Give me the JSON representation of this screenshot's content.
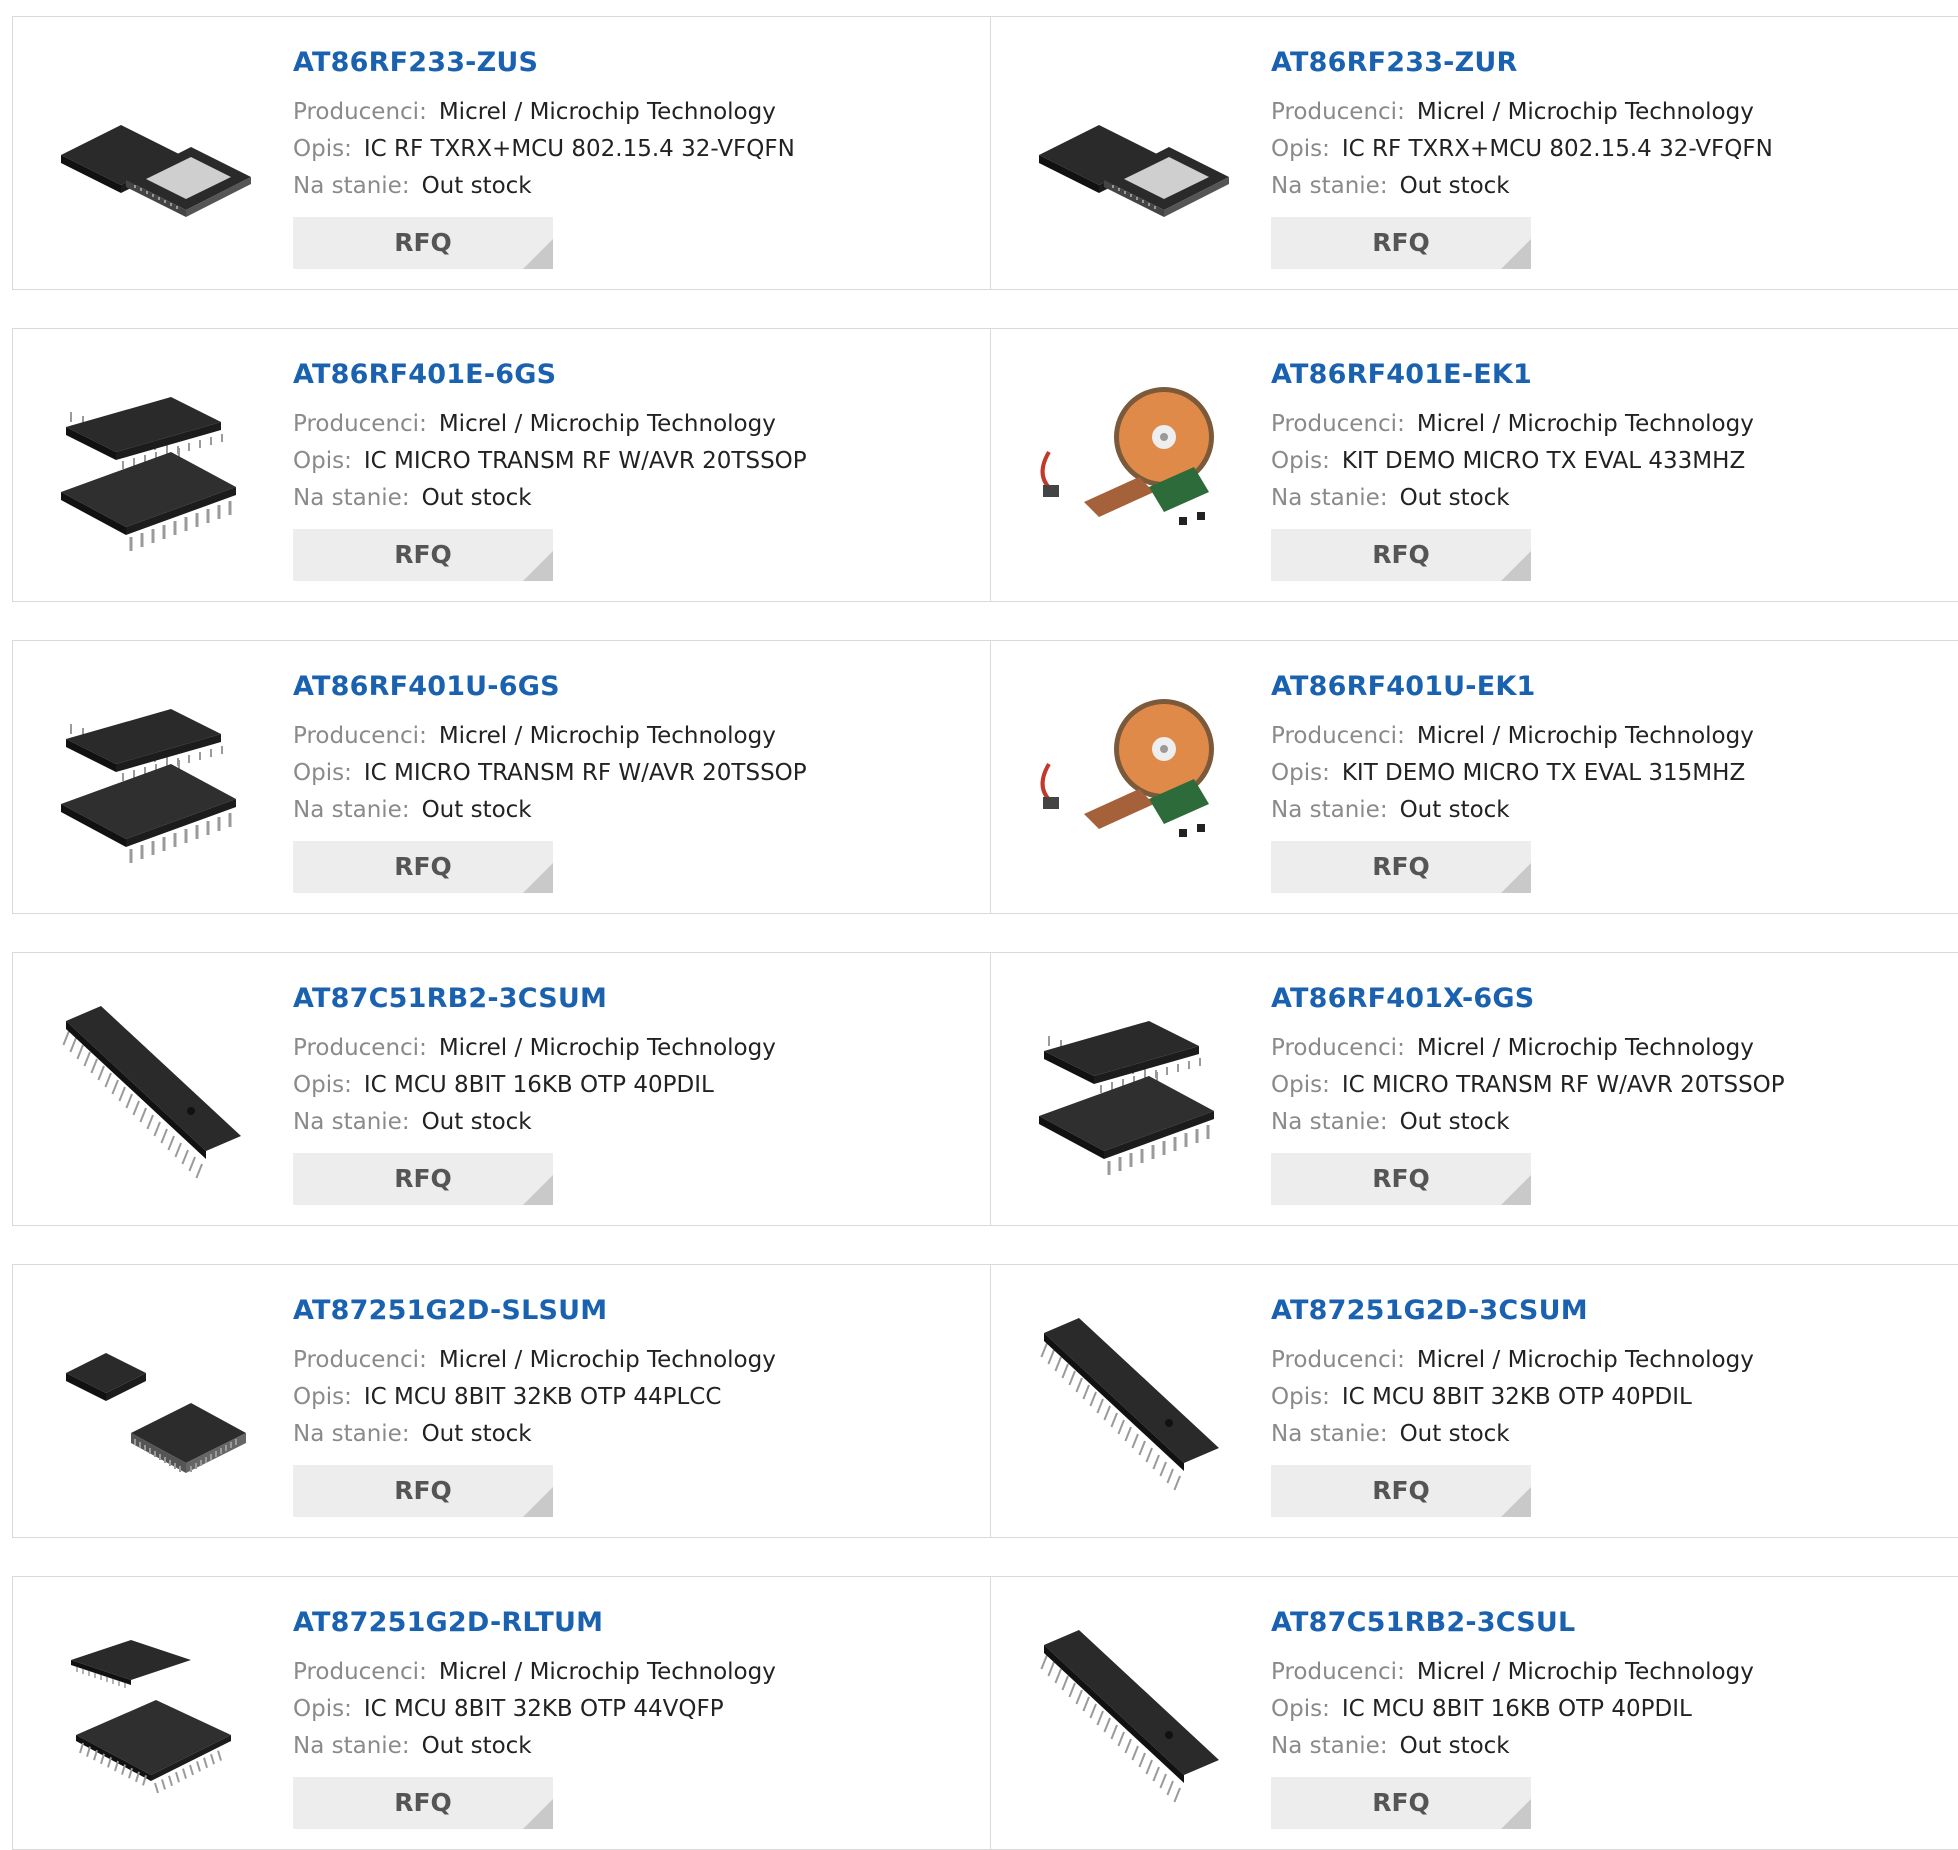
{
  "labels": {
    "manufacturer": "Producenci:",
    "description": "Opis:",
    "stock": "Na stanie:",
    "rfq": "RFQ"
  },
  "products": [
    {
      "part": "AT86RF233-ZUS",
      "manufacturer": "Micrel / Microchip Technology",
      "description": "IC RF TXRX+MCU 802.15.4 32-VFQFN",
      "stock": "Out stock",
      "image": "qfn-chip-icon"
    },
    {
      "part": "AT86RF233-ZUR",
      "manufacturer": "Micrel / Microchip Technology",
      "description": "IC RF TXRX+MCU 802.15.4 32-VFQFN",
      "stock": "Out stock",
      "image": "qfn-chip-icon"
    },
    {
      "part": "AT86RF401E-6GS",
      "manufacturer": "Micrel / Microchip Technology",
      "description": "IC MICRO TRANSM RF W/AVR 20TSSOP",
      "stock": "Out stock",
      "image": "tssop-chip-icon"
    },
    {
      "part": "AT86RF401E-EK1",
      "manufacturer": "Micrel / Microchip Technology",
      "description": "KIT DEMO MICRO TX EVAL 433MHZ",
      "stock": "Out stock",
      "image": "eval-kit-icon"
    },
    {
      "part": "AT86RF401U-6GS",
      "manufacturer": "Micrel / Microchip Technology",
      "description": "IC MICRO TRANSM RF W/AVR 20TSSOP",
      "stock": "Out stock",
      "image": "tssop-chip-icon"
    },
    {
      "part": "AT86RF401U-EK1",
      "manufacturer": "Micrel / Microchip Technology",
      "description": "KIT DEMO MICRO TX EVAL 315MHZ",
      "stock": "Out stock",
      "image": "eval-kit-icon"
    },
    {
      "part": "AT87C51RB2-3CSUM",
      "manufacturer": "Micrel / Microchip Technology",
      "description": "IC MCU 8BIT 16KB OTP 40PDIL",
      "stock": "Out stock",
      "image": "dip-chip-icon"
    },
    {
      "part": "AT86RF401X-6GS",
      "manufacturer": "Micrel / Microchip Technology",
      "description": "IC MICRO TRANSM RF W/AVR 20TSSOP",
      "stock": "Out stock",
      "image": "tssop-chip-icon"
    },
    {
      "part": "AT87251G2D-SLSUM",
      "manufacturer": "Micrel / Microchip Technology",
      "description": "IC MCU 8BIT 32KB OTP 44PLCC",
      "stock": "Out stock",
      "image": "plcc-chip-icon"
    },
    {
      "part": "AT87251G2D-3CSUM",
      "manufacturer": "Micrel / Microchip Technology",
      "description": "IC MCU 8BIT 32KB OTP 40PDIL",
      "stock": "Out stock",
      "image": "dip-chip-icon"
    },
    {
      "part": "AT87251G2D-RLTUM",
      "manufacturer": "Micrel / Microchip Technology",
      "description": "IC MCU 8BIT 32KB OTP 44VQFP",
      "stock": "Out stock",
      "image": "qfp-chip-icon"
    },
    {
      "part": "AT87C51RB2-3CSUL",
      "manufacturer": "Micrel / Microchip Technology",
      "description": "IC MCU 8BIT 16KB OTP 40PDIL",
      "stock": "Out stock",
      "image": "dip-chip-icon"
    }
  ]
}
